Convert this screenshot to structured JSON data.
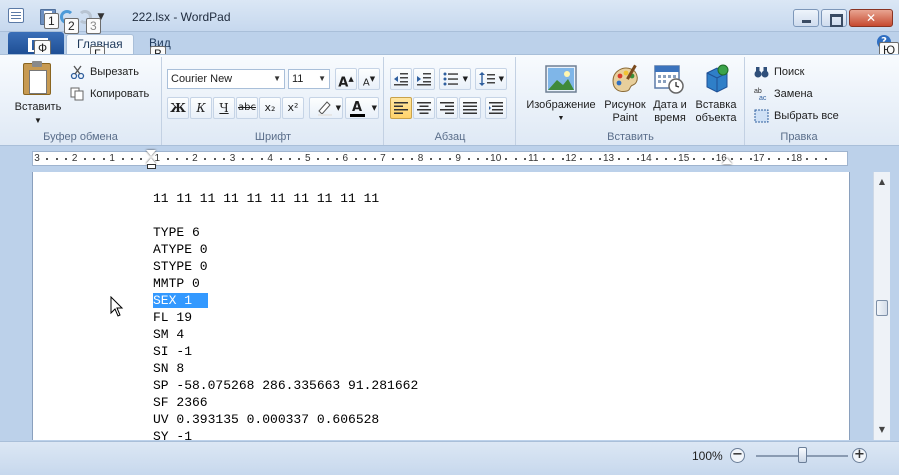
{
  "window": {
    "title": "222.lsx - WordPad"
  },
  "keytips": {
    "file": "Ф",
    "qat1": "1",
    "qat2": "2",
    "qat3": "3",
    "home": "Г",
    "view": "В",
    "help": "Ю"
  },
  "tabs": {
    "home": "Главная",
    "view": "Вид"
  },
  "ribbon": {
    "clipboard": {
      "label": "Буфер обмена",
      "paste": "Вставить",
      "cut": "Вырезать",
      "copy": "Копировать"
    },
    "font": {
      "label": "Шрифт",
      "family": "Courier New",
      "size": "11",
      "bold": "Ж",
      "italic": "К",
      "underline": "Ч",
      "strike": "abc",
      "subscript": "x₂",
      "superscript": "x²",
      "grow": "A",
      "shrink": "A"
    },
    "paragraph": {
      "label": "Абзац"
    },
    "insert": {
      "label": "Вставить",
      "image": "Изображение",
      "paint_line1": "Рисунок",
      "paint_line2": "Paint",
      "datetime_line1": "Дата и",
      "datetime_line2": "время",
      "object_line1": "Вставка",
      "object_line2": "объекта"
    },
    "editing": {
      "label": "Правка",
      "find": "Поиск",
      "replace": "Замена",
      "select_all": "Выбрать все"
    }
  },
  "ruler": {
    "numbers": [
      "3",
      "2",
      "1",
      "1",
      "2",
      "3",
      "4",
      "5",
      "6",
      "7",
      "8",
      "9",
      "10",
      "11",
      "12",
      "13",
      "14",
      "15",
      "16",
      "17",
      "18"
    ]
  },
  "document": {
    "lines": [
      "11 11 11 11 11 11 11 11 11 11",
      "",
      "TYPE 6",
      "ATYPE 0",
      "STYPE 0",
      "MMTP 0",
      "SEX 1",
      "FL 19",
      "SM 4",
      "SI -1",
      "SN 8",
      "SP -58.075268 286.335663 91.281662",
      "SF 2366",
      "UV 0.393135 0.000337 0.606528",
      "SY -1"
    ],
    "selected_index": 6
  },
  "status": {
    "zoom": "100%",
    "zoom_level": 0.5
  },
  "colors": {
    "selection": "#3399ff",
    "accent": "#1f4f95"
  }
}
